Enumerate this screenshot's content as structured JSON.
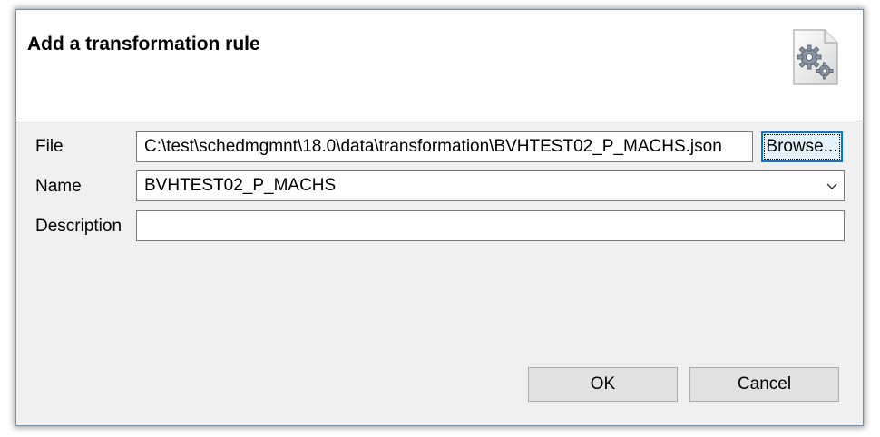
{
  "dialog": {
    "title": "Add a transformation rule",
    "header_icon": "gears-file-icon"
  },
  "form": {
    "file": {
      "label": "File",
      "value": "C:\\test\\schedmgmnt\\18.0\\data\\transformation\\BVHTEST02_P_MACHS.json",
      "browse_label": "Browse..."
    },
    "name": {
      "label": "Name",
      "value": "BVHTEST02_P_MACHS"
    },
    "description": {
      "label": "Description",
      "value": ""
    }
  },
  "buttons": {
    "ok_label": "OK",
    "cancel_label": "Cancel"
  },
  "colors": {
    "focus": "#0078d7",
    "header_bg": "#ffffff",
    "body_bg": "#f0f0f0",
    "button_bg": "#e1e1e1"
  }
}
